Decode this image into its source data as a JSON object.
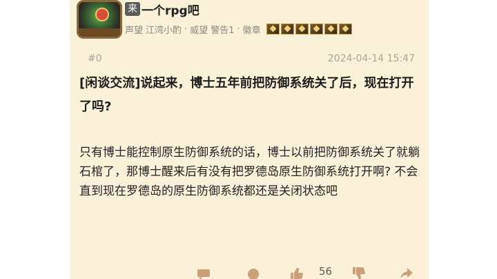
{
  "user": {
    "tag": "来",
    "name": "一个rpg吧",
    "meta": [
      "声望",
      "江湾小酌",
      "·",
      "威望",
      "警告1",
      "·",
      "徽章"
    ]
  },
  "post": {
    "floor": "#0",
    "timestamp": "2024-04-14 15:47",
    "title": "[闲谈交流]说起来，博士五年前把防御系统关了后，现在打开了吗?",
    "body": "只有博士能控制原生防御系统的话，博士以前把防御系统关了就躺石棺了，那博士醒来后有没有把罗德岛原生防御系统打开啊? 不会直到现在罗德岛的原生防御系统都还是关闭状态吧",
    "like_count": "56"
  },
  "icons": [
    "badge-icon",
    "reply-icon",
    "like-icon",
    "dislike-icon",
    "share-icon"
  ],
  "colors": {
    "background": "#fbf1d9",
    "icon": "#c9a07a"
  }
}
